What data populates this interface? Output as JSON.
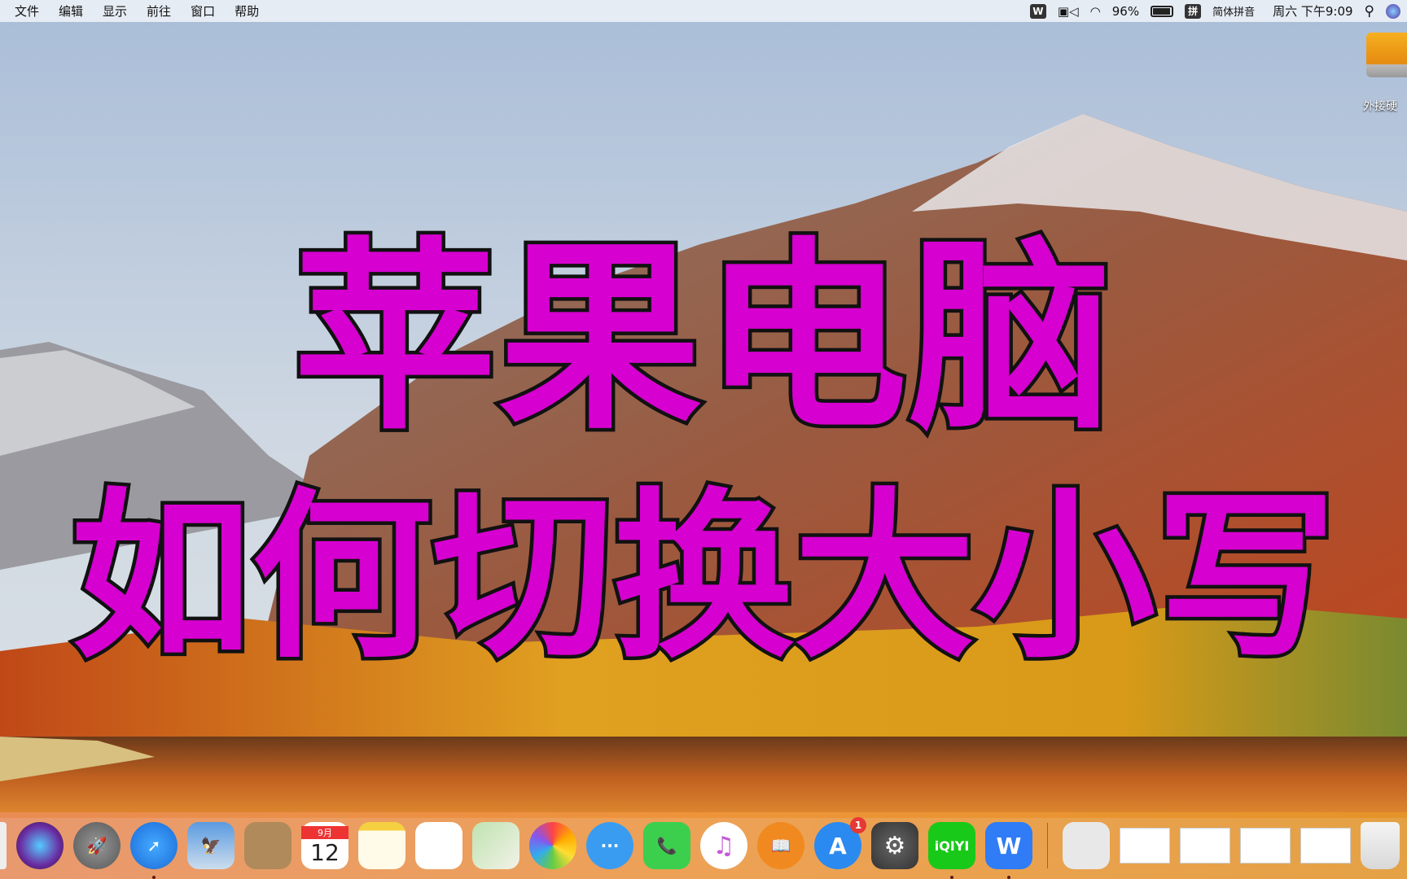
{
  "menubar": {
    "menus": [
      "文件",
      "编辑",
      "显示",
      "前往",
      "窗口",
      "帮助"
    ],
    "battery": "96%",
    "input_icon": "拼",
    "input_method": "简体拼音",
    "clock": "周六 下午9:09",
    "status_icons": [
      "wps-icon",
      "facetime-camera-icon",
      "wifi-icon",
      "battery-icon",
      "search-icon",
      "siri-icon"
    ]
  },
  "desktop": {
    "drive_label": "外接硬"
  },
  "overlay": {
    "line1": "苹果电脑",
    "line2": "如何切换大小写"
  },
  "dock": {
    "calendar_month": "9月",
    "calendar_day": "12",
    "appstore_badge": "1",
    "iqiyi_label": "iQIYI",
    "wps_label": "W"
  }
}
